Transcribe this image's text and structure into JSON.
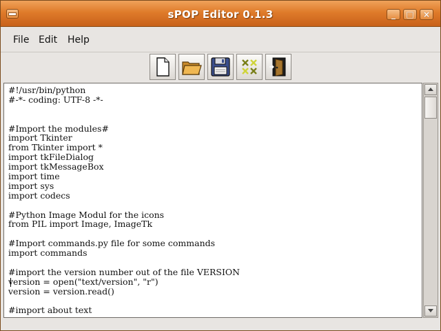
{
  "window": {
    "title": "sPOP Editor 0.1.3",
    "controls": {
      "minimize": "_",
      "maximize": "□",
      "close": "×"
    }
  },
  "menubar": {
    "items": [
      "File",
      "Edit",
      "Help"
    ]
  },
  "toolbar": {
    "buttons": [
      "new-file-icon",
      "open-folder-icon",
      "save-floppy-icon",
      "cut-icon",
      "exit-door-icon"
    ]
  },
  "editor": {
    "lines": [
      "#!/usr/bin/python",
      "#-*- coding: UTF-8 -*-",
      "",
      "",
      "#Import the modules#",
      "import Tkinter",
      "from Tkinter import *",
      "import tkFileDialog",
      "import tkMessageBox",
      "import time",
      "import sys",
      "import codecs",
      "",
      "#Python Image Modul for the icons",
      "from PIL import Image, ImageTk",
      "",
      "#Import commands.py file for some commands",
      "import commands",
      "",
      "#import the version number out of the file VERSION",
      "version = open(\"text/version\", \"r\")",
      "version = version.read()",
      "",
      "#import about text"
    ]
  },
  "colors": {
    "titlebar": "#df7b2a",
    "window_bg": "#e8e5e2",
    "editor_bg": "#ffffff"
  }
}
